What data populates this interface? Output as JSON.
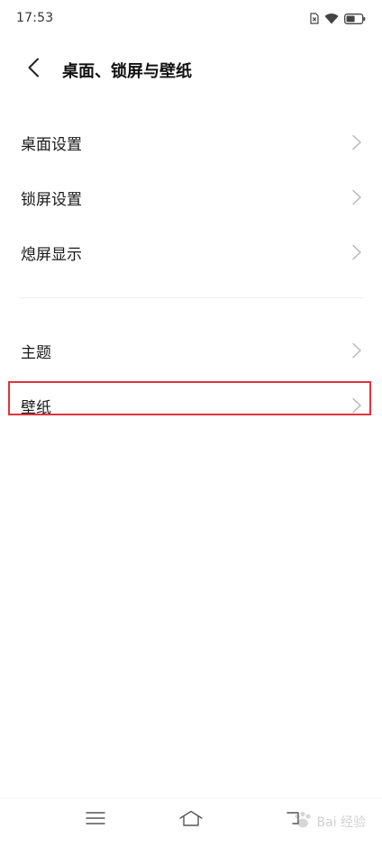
{
  "status_bar": {
    "time": "17:53",
    "icons": [
      "sim-x-icon",
      "wifi-icon",
      "battery-icon"
    ]
  },
  "header": {
    "title": "桌面、锁屏与壁纸",
    "back_icon": "chevron-left-icon"
  },
  "settings": {
    "group_one": [
      {
        "label": "桌面设置"
      },
      {
        "label": "锁屏设置"
      },
      {
        "label": "熄屏显示"
      }
    ],
    "group_two": [
      {
        "label": "主题"
      },
      {
        "label": "壁纸"
      }
    ]
  },
  "highlight": {
    "target": "壁纸",
    "color": "#e0343c"
  },
  "nav_bar": {
    "buttons": [
      "menu-icon",
      "home-icon",
      "back-icon"
    ]
  },
  "watermark": {
    "text": "Bai 经验"
  }
}
